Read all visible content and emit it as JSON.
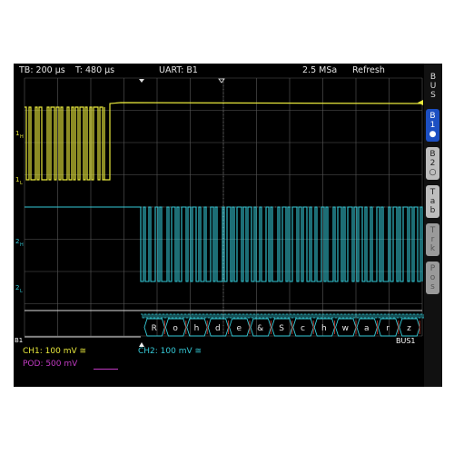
{
  "status_bar": {
    "timebase": "TB: 200 µs",
    "trigger_time": "T: 480 µs",
    "bus": "UART: B1",
    "sample_rate": "2.5 MSa",
    "mode": "Refresh"
  },
  "sidebar": {
    "title": [
      "B",
      "U",
      "S"
    ],
    "buttons": [
      {
        "id": "b1",
        "chars": [
          "B",
          "1",
          "●"
        ],
        "state": "active"
      },
      {
        "id": "b2",
        "chars": [
          "B",
          "2",
          "○"
        ],
        "state": "normal"
      },
      {
        "id": "tab",
        "chars": [
          "T",
          "a",
          "b"
        ],
        "state": "normal"
      },
      {
        "id": "trk",
        "chars": [
          "T",
          "r",
          "k"
        ],
        "state": "dim"
      },
      {
        "id": "pos",
        "chars": [
          "P",
          "o",
          "s"
        ],
        "state": "dim"
      }
    ]
  },
  "channel_markers": {
    "ch1_high": "1H",
    "ch1_low": "1L",
    "ch2_high": "2H",
    "ch2_low": "2L",
    "bus": "B1",
    "bus_label": "BUS1"
  },
  "decoded_frames": [
    "R",
    "o",
    "h",
    "d",
    "e",
    "&",
    "S",
    "c",
    "h",
    "w",
    "a",
    "r",
    "z"
  ],
  "bottom": {
    "ch1": "CH1: 100 mV ≅",
    "ch2": "CH2: 100 mV ≅",
    "pod": "POD: 500 mV"
  },
  "colors": {
    "ch1": "#e8e83c",
    "ch2": "#35c9d6",
    "pod": "#c23bc4",
    "bus": "#dcdcdc",
    "grid": "#5a5a5a",
    "active_button": "#1c4fc2"
  }
}
